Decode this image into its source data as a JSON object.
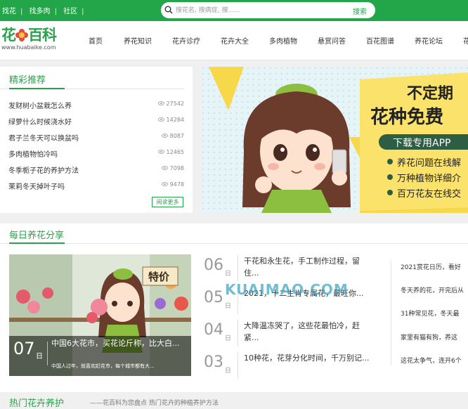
{
  "topbar": {
    "links": [
      "找花",
      "找多肉",
      "社区"
    ],
    "search_placeholder": "搜花名, 搜病症, 搜......",
    "search_button": "搜索"
  },
  "logo": {
    "text_left": "花",
    "text_right": "百科",
    "url": "www.huabaike.com"
  },
  "nav": [
    "首页",
    "养花知识",
    "花卉诊疗",
    "花卉大全",
    "多肉植物",
    "悬赏问答",
    "百花图谱",
    "养花论坛",
    "花"
  ],
  "recommend": {
    "title": "精彩推荐",
    "items": [
      {
        "title": "发财树小盆栽怎么养",
        "views": "27542"
      },
      {
        "title": "绿萝什么时候浇水好",
        "views": "14284"
      },
      {
        "title": "君子兰冬天可以换盆吗",
        "views": "8087"
      },
      {
        "title": "多肉植物怕冷吗",
        "views": "12465"
      },
      {
        "title": "冬季栀子花的养护方法",
        "views": "7098"
      },
      {
        "title": "茉莉冬天掉叶子吗",
        "views": "9478"
      }
    ],
    "more": "阅读更多"
  },
  "banner": {
    "line1": "不定期",
    "line2": "花种免费",
    "button": "下载专用APP",
    "bullets": [
      "养花问题在线解",
      "万种植物详细介",
      "百万花友在线交"
    ]
  },
  "daily": {
    "title": "每日养花分享",
    "photo": {
      "sign": "特价",
      "day": "07",
      "ri": "日",
      "title": "中国6大花市，买花论斤称，比大白...",
      "sub": "中国人过年，就喜欢赶花市，每个城市都有大..."
    },
    "list": [
      {
        "day": "06",
        "ri": "日",
        "text": "干花和永生花，手工制作过程，留住..."
      },
      {
        "day": "05",
        "ri": "日",
        "text": "2021，十二生肖专属花，最旺你..."
      },
      {
        "day": "04",
        "ri": "日",
        "text": "大降温冻哭了，这些花最怕冷，赶紧..."
      },
      {
        "day": "03",
        "ri": "日",
        "text": "10种花，花芽分化时间，千万别记..."
      }
    ],
    "right": [
      "2021赏花日历，看好",
      "冬天养的花，开完后从",
      "31种常见花，冬天最",
      "家里有猫有狗，养这",
      "这花太争气，连开6个"
    ]
  },
  "watermark": "KUAIMAO.COM",
  "bottom": {
    "title": "热门花卉养护",
    "sub": "——花百科为您盘点 热门花卉的种植养护方法"
  },
  "colors": {
    "brand": "#23a64a",
    "accent": "#2aa24b",
    "banner_yellow": "#fbe26a"
  }
}
